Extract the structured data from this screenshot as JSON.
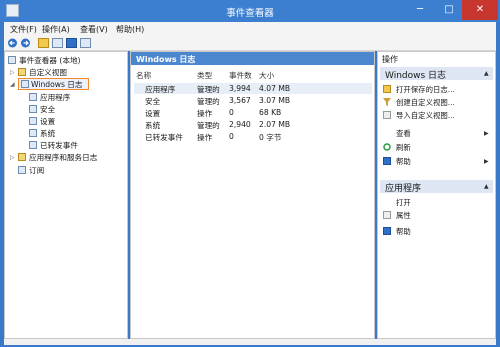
{
  "window": {
    "title": "事件查看器",
    "controls": {
      "minimize": "─",
      "maximize": "□",
      "close": "✕"
    }
  },
  "menu": [
    "文件(F)",
    "操作(A)",
    "查看(V)",
    "帮助(H)"
  ],
  "tree": {
    "root": "事件查看器 (本地)",
    "custom_views": "自定义视图",
    "windows_logs": "Windows 日志",
    "children": [
      "应用程序",
      "安全",
      "设置",
      "系统",
      "已转发事件"
    ],
    "app_service_logs": "应用程序和服务日志",
    "subscriptions": "订阅"
  },
  "middle": {
    "title": "Windows 日志",
    "columns": [
      "名称",
      "类型",
      "事件数",
      "大小"
    ],
    "rows": [
      [
        "应用程序",
        "管理的",
        "3,994",
        "4.07 MB"
      ],
      [
        "安全",
        "管理的",
        "3,567",
        "3.07 MB"
      ],
      [
        "设置",
        "操作",
        "0",
        "68 KB"
      ],
      [
        "系统",
        "管理的",
        "2,940",
        "2.07 MB"
      ],
      [
        "已转发事件",
        "操作",
        "0",
        "0 字节"
      ]
    ]
  },
  "actions": {
    "title": "操作",
    "section1": "Windows 日志",
    "section1_items": [
      "打开保存的日志...",
      "创建自定义视图...",
      "导入自定义视图...",
      "查看",
      "刷新",
      "帮助"
    ],
    "section2": "应用程序",
    "section2_items": [
      "打开",
      "属性",
      "帮助"
    ]
  },
  "colors": {
    "titlebar": "#3c7fd1",
    "header": "#4a87cf",
    "close": "#c7372f",
    "selection": "#e8eef7",
    "highlight_border": "#f08a2b"
  }
}
